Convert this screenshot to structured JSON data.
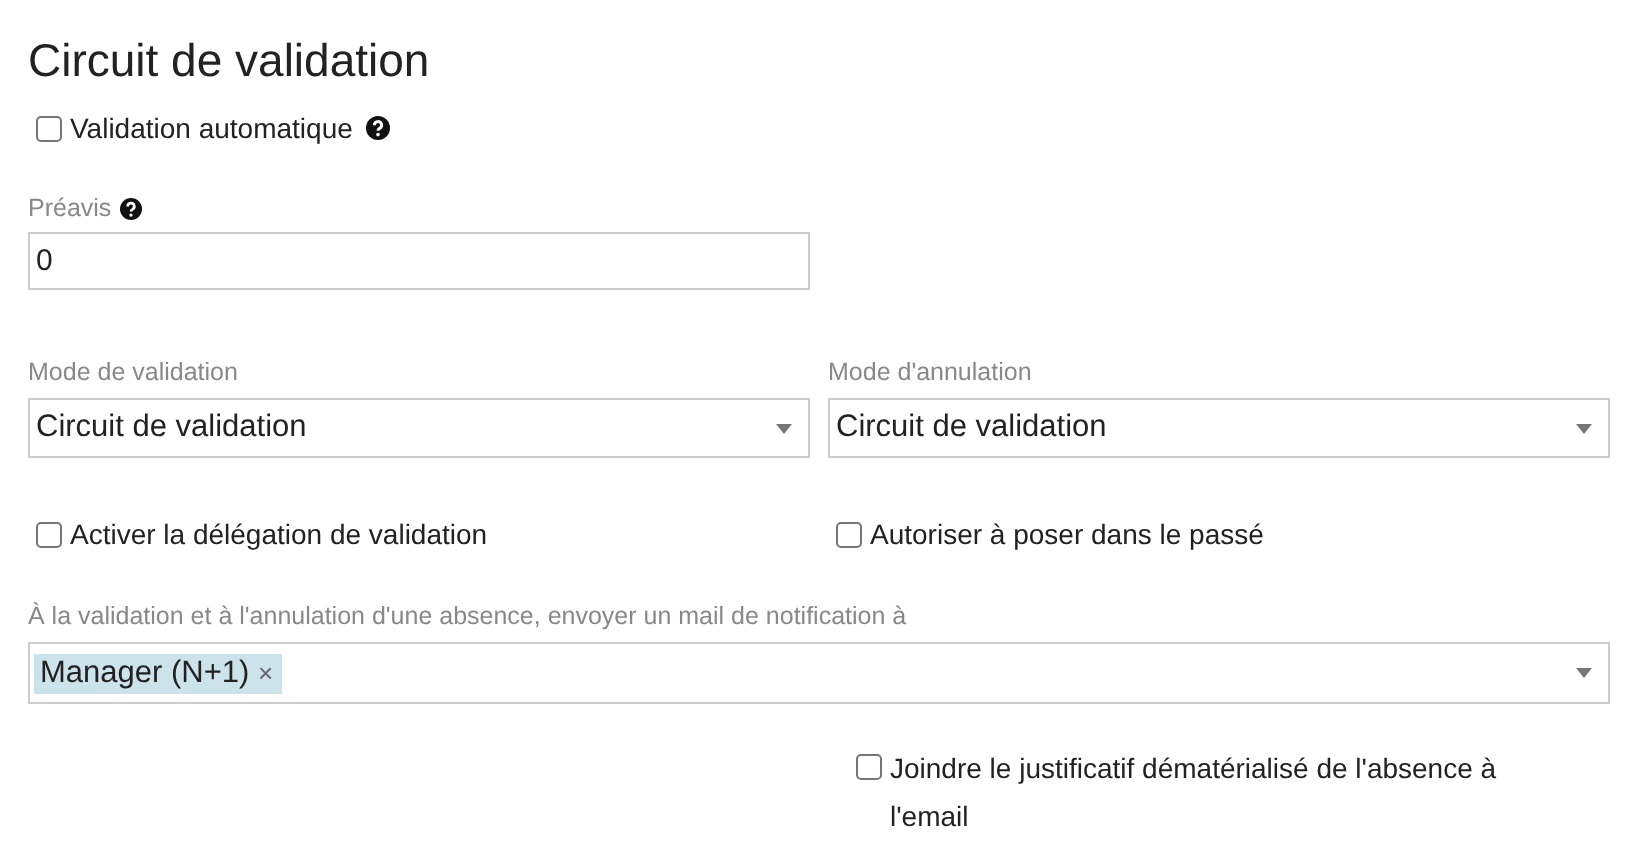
{
  "title": "Circuit de validation",
  "auto_validation": {
    "label": "Validation automatique",
    "checked": false,
    "help": true
  },
  "notice": {
    "label": "Préavis",
    "help": true,
    "value": "0"
  },
  "selects": [
    {
      "label": "Mode de validation",
      "value": "Circuit de validation"
    },
    {
      "label": "Mode d'annulation",
      "value": "Circuit de validation"
    }
  ],
  "options": [
    {
      "label": "Activer la délégation de validation",
      "checked": false
    },
    {
      "label": "Autoriser à poser dans le passé",
      "checked": false
    }
  ],
  "notification": {
    "label": "À la validation et à l'annulation d'une absence, envoyer un mail de notification à",
    "tags": [
      {
        "label": "Manager (N+1)",
        "remove": "×"
      }
    ]
  },
  "attach": {
    "label": "Joindre le justificatif dématérialisé de l'absence à l'email",
    "checked": false
  }
}
